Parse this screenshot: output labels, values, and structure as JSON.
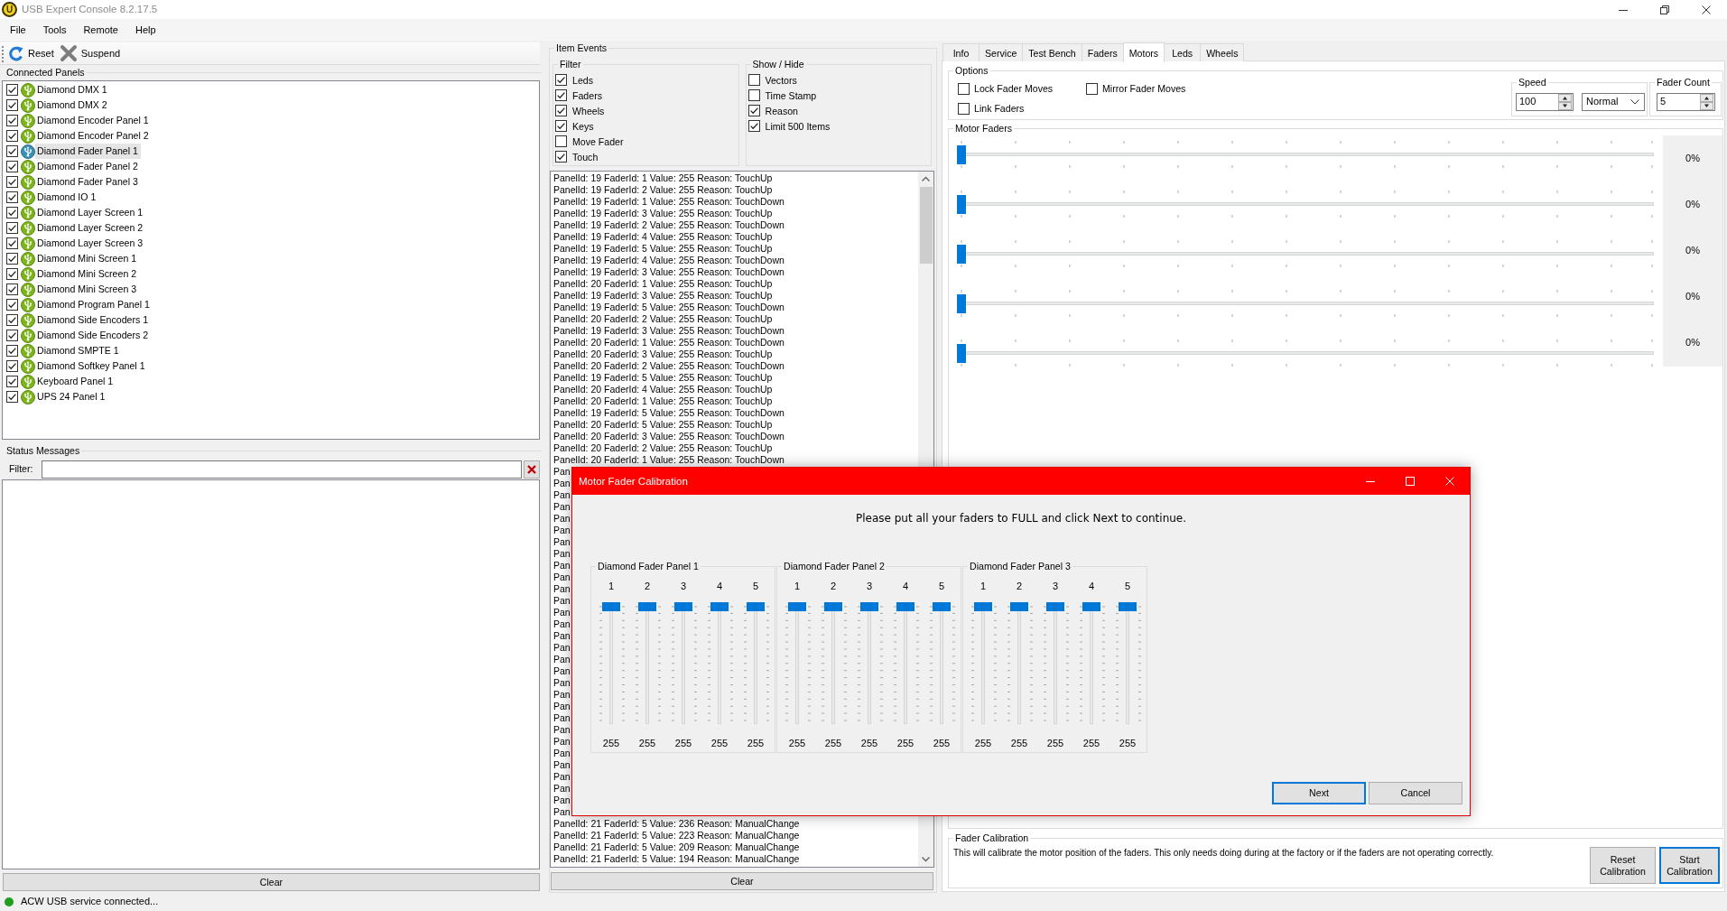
{
  "window": {
    "logo_text": "U",
    "title": "USB Expert Console 8.2.17.5"
  },
  "menu": [
    "File",
    "Tools",
    "Remote",
    "Help"
  ],
  "toolbar": [
    {
      "kind": "reset",
      "label": "Reset"
    },
    {
      "kind": "suspend",
      "label": "Suspend"
    }
  ],
  "connected_panels": {
    "title": "Connected Panels",
    "items": [
      {
        "label": "Diamond DMX 1",
        "checked": true,
        "selected": false
      },
      {
        "label": "Diamond DMX 2",
        "checked": true,
        "selected": false
      },
      {
        "label": "Diamond Encoder Panel 1",
        "checked": true,
        "selected": false
      },
      {
        "label": "Diamond Encoder Panel 2",
        "checked": true,
        "selected": false
      },
      {
        "label": "Diamond Fader Panel 1",
        "checked": true,
        "selected": true
      },
      {
        "label": "Diamond Fader Panel 2",
        "checked": true,
        "selected": false
      },
      {
        "label": "Diamond Fader Panel 3",
        "checked": true,
        "selected": false
      },
      {
        "label": "Diamond IO 1",
        "checked": true,
        "selected": false
      },
      {
        "label": "Diamond Layer Screen 1",
        "checked": true,
        "selected": false
      },
      {
        "label": "Diamond Layer Screen 2",
        "checked": true,
        "selected": false
      },
      {
        "label": "Diamond Layer Screen 3",
        "checked": true,
        "selected": false
      },
      {
        "label": "Diamond Mini Screen 1",
        "checked": true,
        "selected": false
      },
      {
        "label": "Diamond Mini Screen 2",
        "checked": true,
        "selected": false
      },
      {
        "label": "Diamond Mini Screen 3",
        "checked": true,
        "selected": false
      },
      {
        "label": "Diamond Program Panel 1",
        "checked": true,
        "selected": false
      },
      {
        "label": "Diamond Side Encoders 1",
        "checked": true,
        "selected": false
      },
      {
        "label": "Diamond Side Encoders 2",
        "checked": true,
        "selected": false
      },
      {
        "label": "Diamond SMPTE 1",
        "checked": true,
        "selected": false
      },
      {
        "label": "Diamond Softkey Panel 1",
        "checked": true,
        "selected": false
      },
      {
        "label": "Keyboard Panel 1",
        "checked": true,
        "selected": false
      },
      {
        "label": "UPS 24 Panel 1",
        "checked": true,
        "selected": false
      }
    ]
  },
  "status_messages": {
    "title": "Status Messages",
    "filter_label": "Filter:",
    "clear_button": "Clear"
  },
  "item_events": {
    "title": "Item Events",
    "filter": {
      "title": "Filter",
      "options": [
        {
          "label": "Leds",
          "checked": true
        },
        {
          "label": "Faders",
          "checked": true
        },
        {
          "label": "Wheels",
          "checked": true
        },
        {
          "label": "Keys",
          "checked": true
        },
        {
          "label": "Move Fader",
          "checked": false
        },
        {
          "label": "Touch",
          "checked": true
        }
      ]
    },
    "show_hide": {
      "title": "Show / Hide",
      "options": [
        {
          "label": "Vectors",
          "checked": false
        },
        {
          "label": "Time Stamp",
          "checked": false
        },
        {
          "label": "Reason",
          "checked": true
        },
        {
          "label": "Limit 500 Items",
          "checked": true
        }
      ]
    },
    "log": [
      "PanelId: 19 FaderId: 1 Value: 255 Reason: TouchUp",
      "PanelId: 19 FaderId: 2 Value: 255 Reason: TouchUp",
      "PanelId: 19 FaderId: 1 Value: 255 Reason: TouchDown",
      "PanelId: 19 FaderId: 3 Value: 255 Reason: TouchUp",
      "PanelId: 19 FaderId: 2 Value: 255 Reason: TouchDown",
      "PanelId: 19 FaderId: 4 Value: 255 Reason: TouchUp",
      "PanelId: 19 FaderId: 5 Value: 255 Reason: TouchUp",
      "PanelId: 19 FaderId: 4 Value: 255 Reason: TouchDown",
      "PanelId: 19 FaderId: 3 Value: 255 Reason: TouchDown",
      "PanelId: 20 FaderId: 1 Value: 255 Reason: TouchUp",
      "PanelId: 19 FaderId: 3 Value: 255 Reason: TouchUp",
      "PanelId: 19 FaderId: 5 Value: 255 Reason: TouchDown",
      "PanelId: 20 FaderId: 2 Value: 255 Reason: TouchUp",
      "PanelId: 19 FaderId: 3 Value: 255 Reason: TouchDown",
      "PanelId: 20 FaderId: 1 Value: 255 Reason: TouchDown",
      "PanelId: 20 FaderId: 3 Value: 255 Reason: TouchUp",
      "PanelId: 20 FaderId: 2 Value: 255 Reason: TouchDown",
      "PanelId: 19 FaderId: 5 Value: 255 Reason: TouchUp",
      "PanelId: 20 FaderId: 4 Value: 255 Reason: TouchUp",
      "PanelId: 20 FaderId: 1 Value: 255 Reason: TouchUp",
      "PanelId: 19 FaderId: 5 Value: 255 Reason: TouchDown",
      "PanelId: 20 FaderId: 5 Value: 255 Reason: TouchUp",
      "PanelId: 20 FaderId: 3 Value: 255 Reason: TouchDown",
      "PanelId: 20 FaderId: 2 Value: 255 Reason: TouchUp",
      "PanelId: 20 FaderId: 1 Value: 255 Reason: TouchDown",
      "Pan",
      "Pan",
      "Pan",
      "Pan",
      "Pan",
      "Pan",
      "Pan",
      "Pan",
      "Pan",
      "Pan",
      "Pan",
      "Pan",
      "Pan",
      "Pan",
      "Pan",
      "Pan",
      "Pan",
      "Pan",
      "Pan",
      "Pan",
      "Pan",
      "Pan",
      "Pan",
      "Pan",
      "Pan",
      "Pan",
      "Pan",
      "Pan",
      "Pan",
      "Pan",
      "PanelId: 21 FaderId: 5 Value: 236 Reason: ManualChange",
      "PanelId: 21 FaderId: 5 Value: 223 Reason: ManualChange",
      "PanelId: 21 FaderId: 5 Value: 209 Reason: ManualChange",
      "PanelId: 21 FaderId: 5 Value: 194 Reason: ManualChange"
    ],
    "clear_button": "Clear"
  },
  "tabs": [
    {
      "label": "Info",
      "selected": false
    },
    {
      "label": "Service",
      "selected": false
    },
    {
      "label": "Test Bench",
      "selected": false
    },
    {
      "label": "Faders",
      "selected": false
    },
    {
      "label": "Motors",
      "selected": true
    },
    {
      "label": "Leds",
      "selected": false
    },
    {
      "label": "Wheels",
      "selected": false
    }
  ],
  "motors": {
    "options": {
      "title": "Options",
      "checkboxes": [
        {
          "label": "Lock Fader Moves",
          "checked": false
        },
        {
          "label": "Mirror Fader Moves",
          "checked": false
        },
        {
          "label": "Link Faders",
          "checked": false
        }
      ],
      "speed": {
        "title": "Speed",
        "value": "100",
        "mode": "Normal"
      },
      "fader_count": {
        "title": "Fader Count",
        "value": "5"
      }
    },
    "motor_faders": {
      "title": "Motor Faders",
      "faders": [
        {
          "level": 0,
          "reading": "0%"
        },
        {
          "level": 0,
          "reading": "0%"
        },
        {
          "level": 0,
          "reading": "0%"
        },
        {
          "level": 0,
          "reading": "0%"
        },
        {
          "level": 0,
          "reading": "0%"
        }
      ]
    },
    "fader_calibration": {
      "title": "Fader Calibration",
      "description": "This will calibrate the motor position of the faders. This only needs doing during at the factory or if the faders are not operating correctly.",
      "buttons": [
        {
          "label": "Reset Calibration",
          "focused": false
        },
        {
          "label": "Start Calibration",
          "focused": true
        }
      ]
    }
  },
  "dialog": {
    "title": "Motor Fader Calibration",
    "message": "Please put all your faders to FULL and click Next to continue.",
    "panels": [
      {
        "name": "Diamond Fader Panel 1",
        "faders": [
          {
            "label": "1",
            "level": 1,
            "value": "255"
          },
          {
            "label": "2",
            "level": 1,
            "value": "255"
          },
          {
            "label": "3",
            "level": 1,
            "value": "255"
          },
          {
            "label": "4",
            "level": 1,
            "value": "255"
          },
          {
            "label": "5",
            "level": 1,
            "value": "255"
          }
        ]
      },
      {
        "name": "Diamond Fader Panel 2",
        "faders": [
          {
            "label": "1",
            "level": 1,
            "value": "255"
          },
          {
            "label": "2",
            "level": 1,
            "value": "255"
          },
          {
            "label": "3",
            "level": 1,
            "value": "255"
          },
          {
            "label": "4",
            "level": 1,
            "value": "255"
          },
          {
            "label": "5",
            "level": 1,
            "value": "255"
          }
        ]
      },
      {
        "name": "Diamond Fader Panel 3",
        "faders": [
          {
            "label": "1",
            "level": 1,
            "value": "255"
          },
          {
            "label": "2",
            "level": 1,
            "value": "255"
          },
          {
            "label": "3",
            "level": 1,
            "value": "255"
          },
          {
            "label": "4",
            "level": 1,
            "value": "255"
          },
          {
            "label": "5",
            "level": 1,
            "value": "255"
          }
        ]
      }
    ],
    "buttons": [
      {
        "label": "Next",
        "focused": true
      },
      {
        "label": "Cancel",
        "focused": false
      }
    ]
  },
  "status_bar": {
    "text": "ACW USB service connected..."
  }
}
